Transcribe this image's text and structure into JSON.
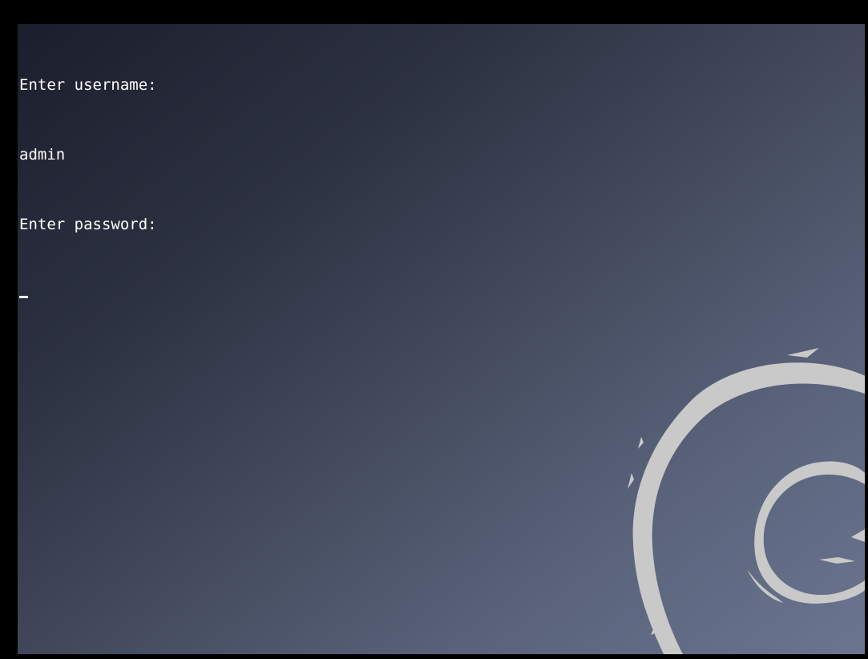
{
  "terminal": {
    "lines": [
      "Enter username:",
      "admin",
      "Enter password:"
    ]
  },
  "background": {
    "logo": "debian-swirl-logo",
    "logo_color": "#c9c9c9",
    "gradient_start": "#1b1e2c",
    "gradient_end": "#6b7590"
  },
  "frame_color": "#000000",
  "text_color": "#ffffff"
}
